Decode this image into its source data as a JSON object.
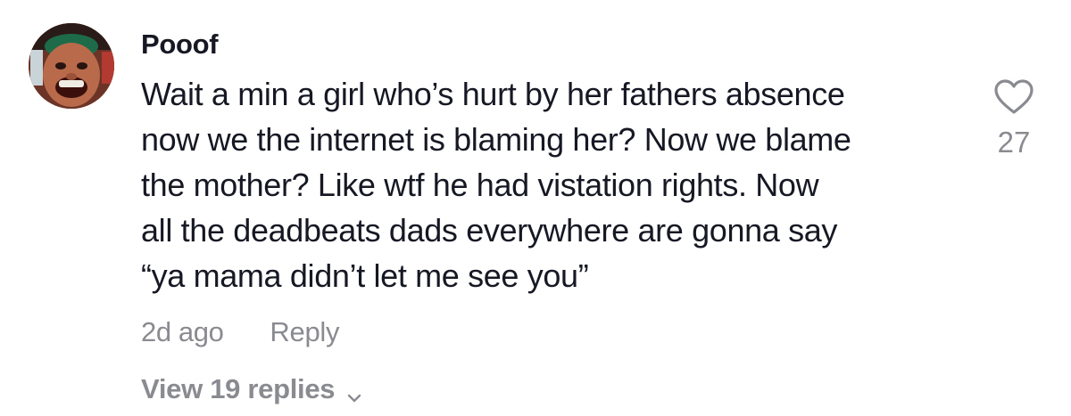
{
  "comment": {
    "username": "Pooof",
    "text_lines": [
      "Wait a min a girl who’s hurt by her fathers absence",
      "now we the internet is blaming her? Now we blame",
      "the mother? Like wtf he had vistation rights. Now",
      "all the deadbeats dads everywhere are gonna say",
      "“ya mama didn’t let me see you”"
    ],
    "timestamp": "2d ago",
    "reply_label": "Reply",
    "view_replies_label": "View 19 replies",
    "like_count": "27",
    "icons": {
      "like": "heart-outline-icon",
      "expand": "chevron-down-icon"
    },
    "colors": {
      "text": "#161823",
      "muted": "#8a8b91"
    }
  }
}
